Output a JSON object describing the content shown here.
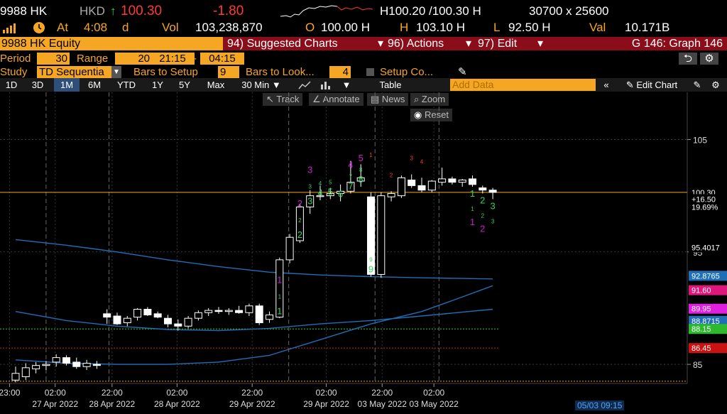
{
  "quote": {
    "ticker": "9988 HK",
    "currency": "HKD",
    "up_arrow": "↑",
    "last": "100.30",
    "change": "-1.80",
    "bid_ask": "H100.20 /100.30 H",
    "size": "30700 x 25600",
    "at_label": "At",
    "time": "4:08",
    "time_flag": "d",
    "vol_label": "Vol",
    "volume": "103,238,870",
    "open_label": "O",
    "open": "100.00 H",
    "high_label": "H",
    "high": "103.10 H",
    "low_label": "L",
    "low": "92.50 H",
    "val_label": "Val",
    "value": "10.171B"
  },
  "menubar": {
    "title": "9988 HK Equity",
    "suggested": "94) Suggested Charts",
    "actions": "96) Actions",
    "edit": "97) Edit",
    "graph": "G 146: Graph 146"
  },
  "params": {
    "period_label": "Period",
    "period": "30",
    "range_label": "Range",
    "range": "20",
    "time_from": "21:15",
    "dash": "-",
    "time_to": "04:15"
  },
  "study": {
    "label": "Study",
    "name": "TD Sequentia",
    "bars_setup_label": "Bars to Setup",
    "bars_setup": "9",
    "bars_look_label": "Bars to Look...",
    "bars_look": "4",
    "setup_label": "Setup Co..."
  },
  "toolbar": {
    "periods": [
      "1D",
      "3D",
      "1M",
      "6M",
      "YTD",
      "1Y",
      "5Y",
      "Max"
    ],
    "selected": "1M",
    "interval": "30 Min",
    "table": "Table",
    "add_data": "Add Data",
    "edit_chart": "Edit Chart"
  },
  "tools": {
    "track": "Track",
    "annotate": "Annotate",
    "news": "News",
    "zoom": "Zoom",
    "reset": "Reset"
  },
  "timestamp": "05/03 09:15",
  "colors": {
    "amber": "#f5a623",
    "up": "#31d35e",
    "down": "#ff3b30",
    "menu": "#8b0d1a",
    "ma": "#1e6fb8"
  },
  "chart_data": {
    "type": "candlestick",
    "ylim": [
      83.3,
      109.2
    ],
    "y_ticks": [
      85,
      95,
      105
    ],
    "x_tick_labels": [
      {
        "time": "23:00",
        "date": ""
      },
      {
        "time": "02:00",
        "date": "27 Apr 2022"
      },
      {
        "time": "22:00",
        "date": "28 Apr 2022"
      },
      {
        "time": "02:00",
        "date": "28 Apr 2022"
      },
      {
        "time": "22:00",
        "date": "29 Apr 2022"
      },
      {
        "time": "02:00",
        "date": "29 Apr 2022"
      },
      {
        "time": "22:00",
        "date": "03 May 2022"
      },
      {
        "time": "02:00",
        "date": "03 May 2022"
      }
    ],
    "candles": [
      {
        "o": 83.6,
        "h": 84.8,
        "l": 83.4,
        "c": 84.2
      },
      {
        "o": 83.9,
        "h": 85.1,
        "l": 83.6,
        "c": 84.7
      },
      {
        "o": 84.6,
        "h": 85.2,
        "l": 84.2,
        "c": 84.9
      },
      {
        "o": 84.9,
        "h": 85.3,
        "l": 84.5,
        "c": 85.0
      },
      {
        "o": 85.2,
        "h": 85.9,
        "l": 84.8,
        "c": 85.6
      },
      {
        "o": 85.6,
        "h": 85.8,
        "l": 84.9,
        "c": 85.1
      },
      {
        "o": 85.2,
        "h": 85.6,
        "l": 84.6,
        "c": 84.8
      },
      {
        "o": 84.8,
        "h": 85.4,
        "l": 84.5,
        "c": 85.1
      },
      {
        "o": 85.0,
        "h": 85.3,
        "l": 84.6,
        "c": 84.9
      },
      {
        "o": 89.5,
        "h": 89.9,
        "l": 88.6,
        "c": 89.2
      },
      {
        "o": 89.3,
        "h": 89.6,
        "l": 88.5,
        "c": 88.6
      },
      {
        "o": 88.7,
        "h": 89.3,
        "l": 88.4,
        "c": 89.1
      },
      {
        "o": 89.2,
        "h": 90.0,
        "l": 88.9,
        "c": 89.9
      },
      {
        "o": 89.9,
        "h": 90.1,
        "l": 89.3,
        "c": 89.4
      },
      {
        "o": 89.5,
        "h": 89.7,
        "l": 89.1,
        "c": 89.2
      },
      {
        "o": 89.1,
        "h": 89.4,
        "l": 88.3,
        "c": 88.6
      },
      {
        "o": 88.6,
        "h": 89.0,
        "l": 88.0,
        "c": 88.4
      },
      {
        "o": 88.4,
        "h": 89.3,
        "l": 88.2,
        "c": 89.1
      },
      {
        "o": 89.1,
        "h": 89.8,
        "l": 88.9,
        "c": 89.6
      },
      {
        "o": 89.6,
        "h": 90.0,
        "l": 89.3,
        "c": 89.8
      },
      {
        "o": 89.8,
        "h": 90.1,
        "l": 89.5,
        "c": 89.7
      },
      {
        "o": 89.7,
        "h": 90.0,
        "l": 89.4,
        "c": 89.8
      },
      {
        "o": 89.8,
        "h": 90.2,
        "l": 89.5,
        "c": 89.6
      },
      {
        "o": 89.6,
        "h": 90.4,
        "l": 89.3,
        "c": 90.2
      },
      {
        "o": 90.2,
        "h": 90.4,
        "l": 88.5,
        "c": 88.7
      },
      {
        "o": 89.0,
        "h": 89.7,
        "l": 88.7,
        "c": 89.4
      },
      {
        "o": 89.2,
        "h": 94.5,
        "l": 89.1,
        "c": 94.3
      },
      {
        "o": 94.3,
        "h": 96.6,
        "l": 94.0,
        "c": 96.3
      },
      {
        "o": 96.0,
        "h": 99.3,
        "l": 95.8,
        "c": 99.0
      },
      {
        "o": 99.0,
        "h": 100.5,
        "l": 98.4,
        "c": 100.0
      },
      {
        "o": 100.0,
        "h": 100.9,
        "l": 99.6,
        "c": 100.0
      },
      {
        "o": 100.0,
        "h": 100.7,
        "l": 99.7,
        "c": 100.2
      },
      {
        "o": 100.2,
        "h": 101.0,
        "l": 99.5,
        "c": 100.4
      },
      {
        "o": 100.4,
        "h": 103.1,
        "l": 100.2,
        "c": 101.2
      },
      {
        "o": 101.3,
        "h": 102.8,
        "l": 100.8,
        "c": 101.6
      },
      {
        "o": 99.9,
        "h": 100.3,
        "l": 92.8,
        "c": 93.0
      },
      {
        "o": 93.0,
        "h": 100.3,
        "l": 92.7,
        "c": 100.0
      },
      {
        "o": 99.9,
        "h": 100.4,
        "l": 99.5,
        "c": 100.2
      },
      {
        "o": 100.0,
        "h": 101.8,
        "l": 99.8,
        "c": 101.6
      },
      {
        "o": 101.4,
        "h": 101.9,
        "l": 100.7,
        "c": 100.9
      },
      {
        "o": 100.9,
        "h": 101.6,
        "l": 100.3,
        "c": 100.5
      },
      {
        "o": 100.5,
        "h": 101.4,
        "l": 100.3,
        "c": 101.3
      },
      {
        "o": 101.2,
        "h": 102.5,
        "l": 100.9,
        "c": 101.5
      },
      {
        "o": 101.5,
        "h": 101.7,
        "l": 101.0,
        "c": 101.2
      },
      {
        "o": 101.2,
        "h": 101.5,
        "l": 100.8,
        "c": 101.4
      },
      {
        "o": 101.5,
        "h": 101.8,
        "l": 100.8,
        "c": 101.0
      },
      {
        "o": 100.7,
        "h": 100.9,
        "l": 100.2,
        "c": 100.5
      },
      {
        "o": 100.5,
        "h": 100.7,
        "l": 99.7,
        "c": 100.3
      }
    ],
    "td_counts": [
      {
        "bar": 26,
        "color": "#31d35e",
        "labels": [
          "1",
          "1"
        ]
      },
      {
        "bar": 26,
        "color": "#c81ec8",
        "labels": [
          "1"
        ]
      },
      {
        "bar": 28,
        "color": "#31d35e",
        "labels": [
          "2",
          "2"
        ]
      },
      {
        "bar": 28,
        "color": "#c81ec8",
        "labels": [
          "2"
        ]
      },
      {
        "bar": 29,
        "color": "#31d35e",
        "labels": [
          "3",
          "3"
        ]
      },
      {
        "bar": 29,
        "color": "#c81ec8",
        "labels": [
          "3"
        ]
      },
      {
        "bar": 30,
        "color": "#31d35e",
        "labels": [
          "4",
          "4"
        ]
      },
      {
        "bar": 31,
        "color": "#31d35e",
        "labels": [
          "5",
          "5"
        ]
      },
      {
        "bar": 32,
        "color": "#31d35e",
        "labels": [
          "6"
        ]
      },
      {
        "bar": 33,
        "color": "#31d35e",
        "labels": [
          "7",
          "7"
        ]
      },
      {
        "bar": 33,
        "color": "#c81ec8",
        "labels": [
          "4"
        ]
      },
      {
        "bar": 34,
        "color": "#31d35e",
        "labels": [
          "8",
          "8"
        ]
      },
      {
        "bar": 34,
        "color": "#c81ec8",
        "labels": [
          "5"
        ]
      },
      {
        "bar": 35,
        "color": "#31d35e",
        "labels": [
          "9",
          "9"
        ]
      },
      {
        "bar": 35,
        "color": "#ff3b30",
        "labels": [
          "1"
        ]
      },
      {
        "bar": 37,
        "color": "#ff3b30",
        "labels": [
          "2"
        ]
      },
      {
        "bar": 39,
        "color": "#ff3b30",
        "labels": [
          "3"
        ]
      },
      {
        "bar": 40,
        "color": "#ff3b30",
        "labels": [
          "4"
        ]
      },
      {
        "bar": 45,
        "color": "#31d35e",
        "labels": [
          "1",
          "1"
        ]
      },
      {
        "bar": 45,
        "color": "#c81ec8",
        "labels": [
          "1"
        ]
      },
      {
        "bar": 46,
        "color": "#31d35e",
        "labels": [
          "2",
          "2"
        ]
      },
      {
        "bar": 46,
        "color": "#c81ec8",
        "labels": [
          "2"
        ]
      },
      {
        "bar": 47,
        "color": "#31d35e",
        "labels": [
          "3",
          "3"
        ]
      }
    ],
    "moving_averages": [
      {
        "color": "#1e6fb8",
        "points": [
          [
            0,
            96.1
          ],
          [
            5,
            95.6
          ],
          [
            10,
            95.0
          ],
          [
            15,
            94.3
          ],
          [
            20,
            93.7
          ],
          [
            25,
            93.2
          ],
          [
            30,
            92.95
          ],
          [
            35,
            92.8
          ],
          [
            40,
            92.7
          ],
          [
            47,
            92.6
          ]
        ]
      },
      {
        "color": "#1e6fb8",
        "points": [
          [
            0,
            85.4
          ],
          [
            5,
            85.1
          ],
          [
            10,
            85.0
          ],
          [
            15,
            85.0
          ],
          [
            20,
            85.2
          ],
          [
            25,
            85.8
          ],
          [
            30,
            87.2
          ],
          [
            35,
            88.6
          ],
          [
            40,
            89.7
          ],
          [
            44,
            91.0
          ],
          [
            47,
            92.0
          ]
        ]
      },
      {
        "color": "#1e6fb8",
        "points": [
          [
            0,
            89.7
          ],
          [
            5,
            88.9
          ],
          [
            10,
            88.4
          ],
          [
            15,
            88.1
          ],
          [
            20,
            88.0
          ],
          [
            25,
            88.2
          ],
          [
            30,
            88.6
          ],
          [
            35,
            88.9
          ],
          [
            40,
            89.3
          ],
          [
            47,
            89.9
          ]
        ]
      }
    ],
    "reference_lines": [
      {
        "value": 100.3,
        "color": "#f5a623",
        "style": "solid"
      },
      {
        "value": 88.15,
        "color": "#33cc33",
        "style": "dotted"
      },
      {
        "value": 86.45,
        "color": "#cc2222",
        "style": "dotted"
      },
      {
        "value": 83.5,
        "color": "#f5a623",
        "style": "dotted"
      }
    ],
    "price_labels": [
      {
        "text": "100.30",
        "value": 100.3,
        "bg": "#000",
        "fg": "#fff"
      },
      {
        "text": "+16.50",
        "value": 99.7,
        "bg": "#000",
        "fg": "#fff"
      },
      {
        "text": "19.69%",
        "value": 99.0,
        "bg": "#000",
        "fg": "#fff"
      },
      {
        "text": "95.4017",
        "value": 95.4017,
        "bg": "#000",
        "fg": "#fff"
      },
      {
        "text": "92.8765",
        "value": 92.8765,
        "bg": "#1e6fb8",
        "fg": "#fff"
      },
      {
        "text": "91.60",
        "value": 91.6,
        "bg": "#e0177b",
        "fg": "#fff"
      },
      {
        "text": "89.95",
        "value": 89.95,
        "bg": "#e020e0",
        "fg": "#fff"
      },
      {
        "text": "88.8715",
        "value": 88.8715,
        "bg": "#1e6fb8",
        "fg": "#fff"
      },
      {
        "text": "88.15",
        "value": 88.15,
        "bg": "#2eb82e",
        "fg": "#fff"
      },
      {
        "text": "86.45",
        "value": 86.45,
        "bg": "#cc1111",
        "fg": "#fff"
      }
    ]
  }
}
